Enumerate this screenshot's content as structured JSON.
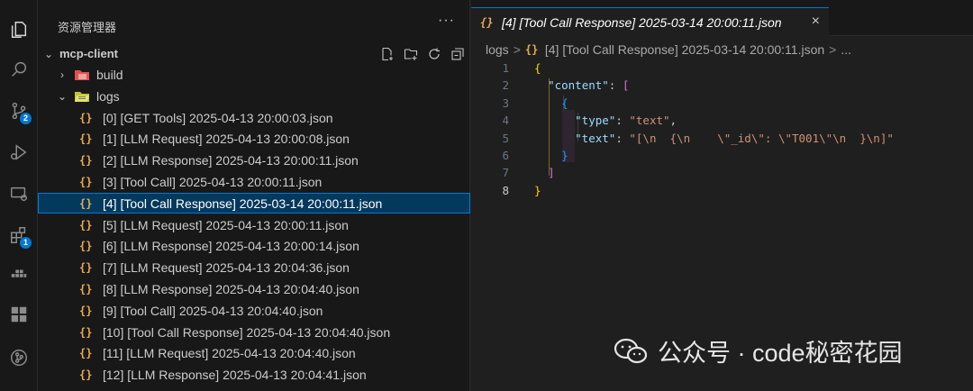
{
  "activity_bar": {
    "scm_badge": "2",
    "extensions_badge": "1"
  },
  "sidebar": {
    "title": "资源管理器",
    "more": "···",
    "root": "mcp-client",
    "build": "build",
    "logs": "logs",
    "bracket_icon": "{}",
    "files": [
      "[0] [GET Tools] 2025-04-13 20:00:03.json",
      "[1] [LLM Request] 2025-04-13 20:00:08.json",
      "[2] [LLM Response] 2025-04-13 20:00:11.json",
      "[3] [Tool Call] 2025-04-13 20:00:11.json",
      "[4] [Tool Call Response] 2025-03-14 20:00:11.json",
      "[5] [LLM Request] 2025-04-13 20:00:11.json",
      "[6] [LLM Response] 2025-04-13 20:00:14.json",
      "[7] [LLM Request] 2025-04-13 20:04:36.json",
      "[8] [LLM Response] 2025-04-13 20:04:40.json",
      "[9] [Tool Call] 2025-04-13 20:04:40.json",
      "[10] [Tool Call Response] 2025-04-13 20:04:40.json",
      "[11] [LLM Request] 2025-04-13 20:04:40.json",
      "[12] [LLM Response] 2025-04-13 20:04:41.json"
    ],
    "selected_index": 4
  },
  "editor": {
    "tab_title": "[4] [Tool Call Response] 2025-03-14 20:00:11.json",
    "tab_close": "×",
    "breadcrumb": {
      "folder": "logs",
      "sep": ">",
      "file": "[4] [Tool Call Response] 2025-03-14 20:00:11.json",
      "tail": "..."
    },
    "line_numbers": [
      "1",
      "2",
      "3",
      "4",
      "5",
      "6",
      "7",
      "8"
    ],
    "active_line": 8,
    "code": {
      "key_content": "\"content\"",
      "key_type": "\"type\"",
      "val_type": "\"text\"",
      "key_text": "\"text\"",
      "val_text": "\"[\\n  {\\n    \\\"_id\\\": \\\"T001\\\"\\n  }\\n]\""
    }
  },
  "watermark": {
    "text": "公众号 · code秘密花园"
  },
  "colors": {
    "selection_bg": "#04395e",
    "selection_border": "#0078d4",
    "json_icon": "#e8ab53",
    "badge": "#0078d4"
  }
}
